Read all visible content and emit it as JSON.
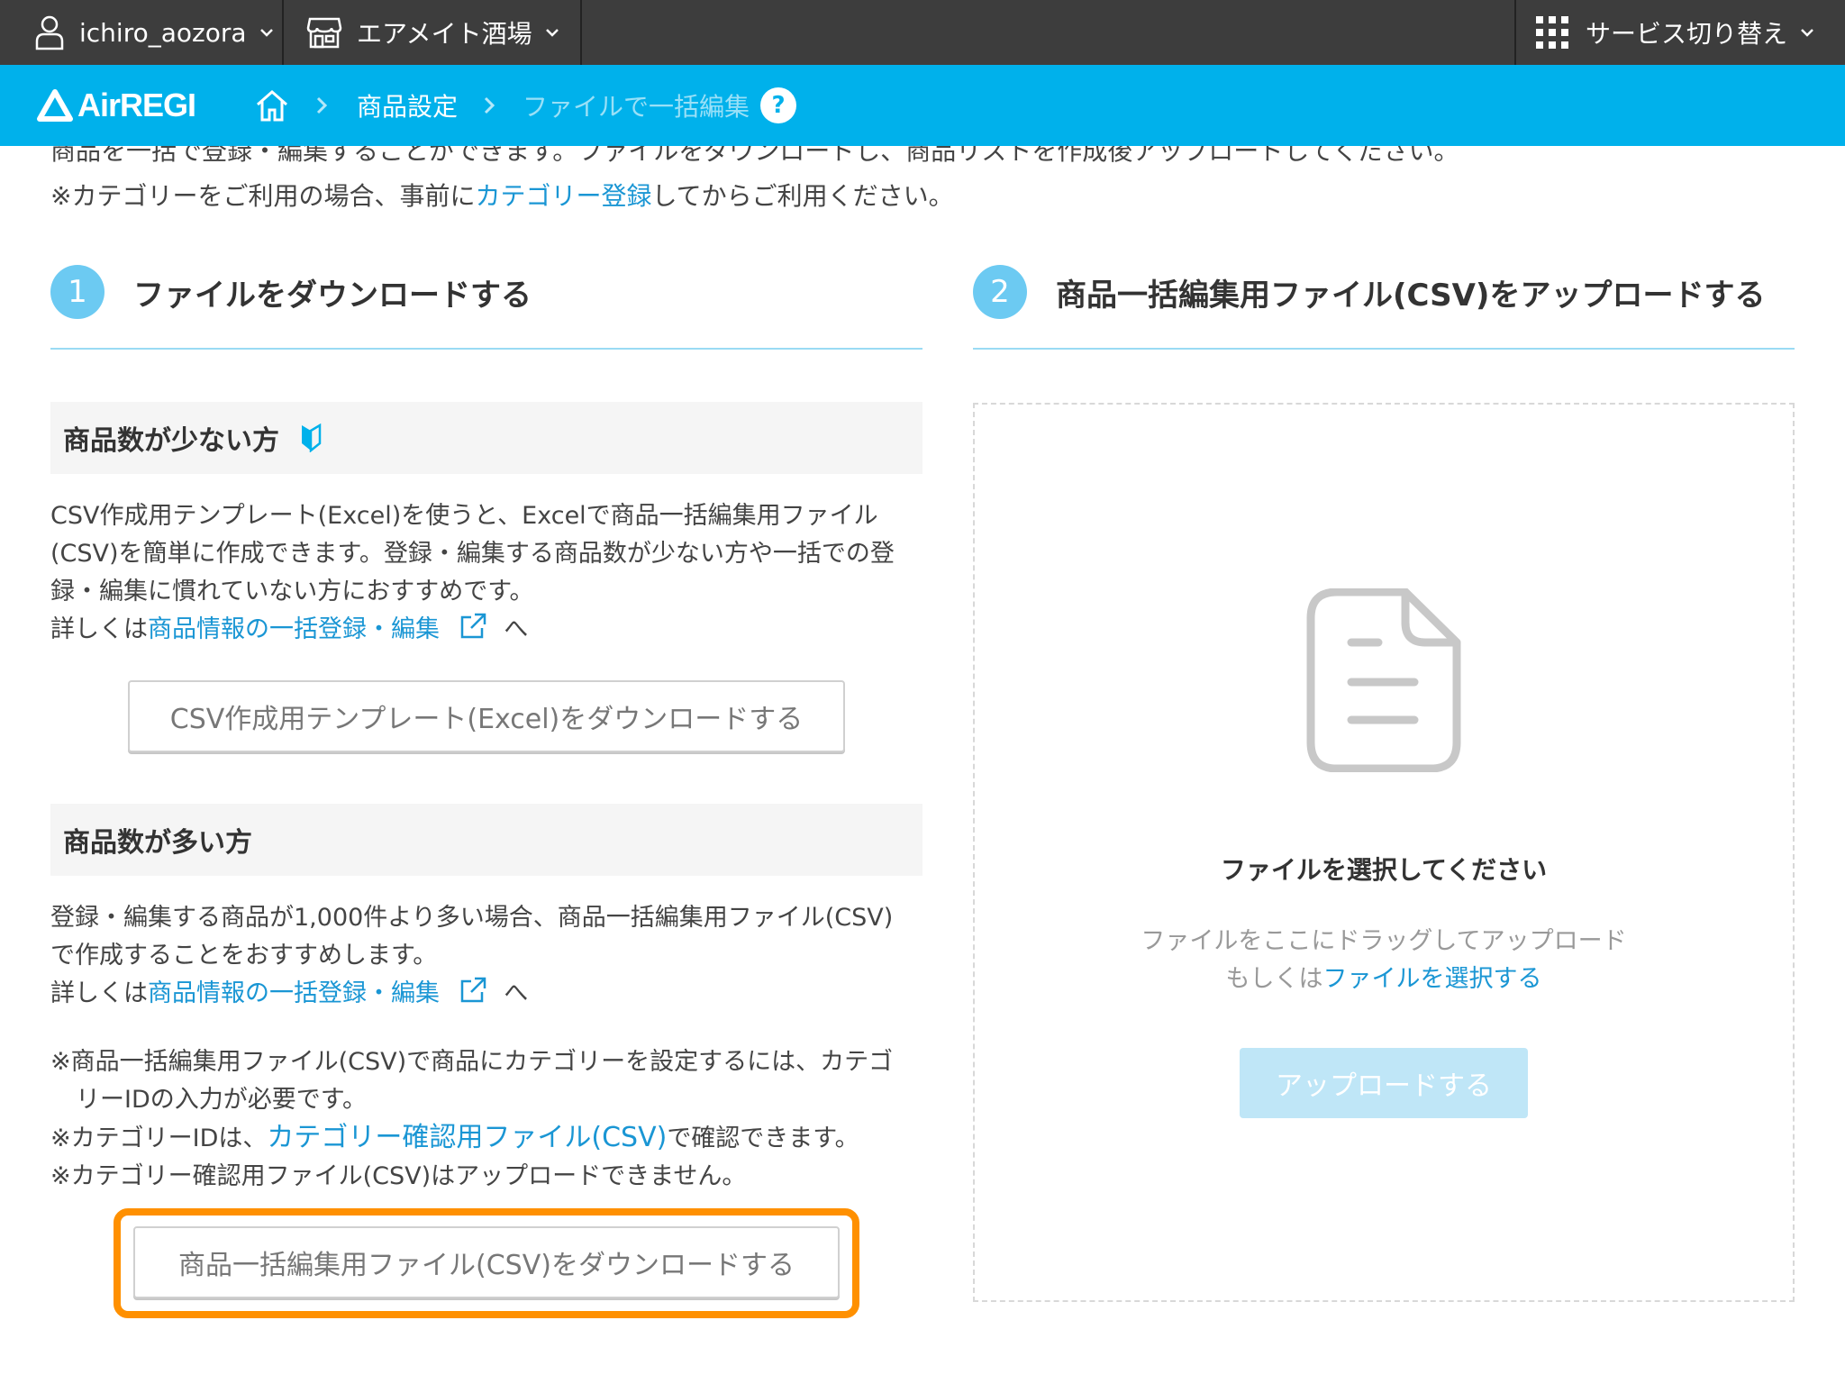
{
  "topbar": {
    "user_name": "ichiro_aozora",
    "store_name": "エアメイト酒場",
    "service_switch": "サービス切り替え"
  },
  "header": {
    "logo_text": "AirREGI",
    "breadcrumb": [
      "商品設定",
      "ファイルで一括編集"
    ],
    "help_label": "?"
  },
  "intro": {
    "line1": "商品を一括で登録・編集することができます。ファイルをダウンロードし、商品リストを作成後アップロードしてください。",
    "line2_prefix": "※カテゴリーをご利用の場合、事前に",
    "line2_link": "カテゴリー登録",
    "line2_suffix": "してからご利用ください。"
  },
  "step1": {
    "number": "1",
    "title": "ファイルをダウンロードする",
    "few": {
      "heading": "商品数が少ない方",
      "lines": [
        "CSV作成用テンプレート(Excel)を使うと、Excelで商品一括編集用ファイル",
        "(CSV)を簡単に作成できます。登録・編集する商品数が少ない方や一括での登",
        "録・編集に慣れていない方におすすめです。"
      ],
      "detail_prefix": "詳しくは",
      "detail_link": "商品情報の一括登録・編集",
      "detail_suffix": "へ",
      "button": "CSV作成用テンプレート(Excel)をダウンロードする"
    },
    "many": {
      "heading": "商品数が多い方",
      "lines": [
        "登録・編集する商品が1,000件より多い場合、商品一括編集用ファイル(CSV)",
        "で作成することをおすすめします。"
      ],
      "detail_prefix": "詳しくは",
      "detail_link": "商品情報の一括登録・編集",
      "detail_suffix": "へ",
      "note1a": "※商品一括編集用ファイル(CSV)で商品にカテゴリーを設定するには、カテゴ",
      "note1b": "リーIDの入力が必要です。",
      "note2_prefix": "※カテゴリーIDは、",
      "note2_link": "カテゴリー確認用ファイル(CSV)",
      "note2_suffix": "で確認できます。",
      "note3": "※カテゴリー確認用ファイル(CSV)はアップロードできません。",
      "button": "商品一括編集用ファイル(CSV)をダウンロードする"
    }
  },
  "step2": {
    "number": "2",
    "title": "商品一括編集用ファイル(CSV)をアップロードする",
    "drop_title": "ファイルを選択してください",
    "drop_hint": "ファイルをここにドラッグしてアップロード",
    "select_prefix": "もしくは",
    "select_link": "ファイルを選択する",
    "upload_button": "アップロードする"
  },
  "colors": {
    "topbar": "#3d3d3d",
    "header": "#00b1eb",
    "link": "#1a96d4",
    "step_circle": "#6ccaf2",
    "highlight": "#ff9000",
    "upload_disabled": "#bfe6f7"
  }
}
